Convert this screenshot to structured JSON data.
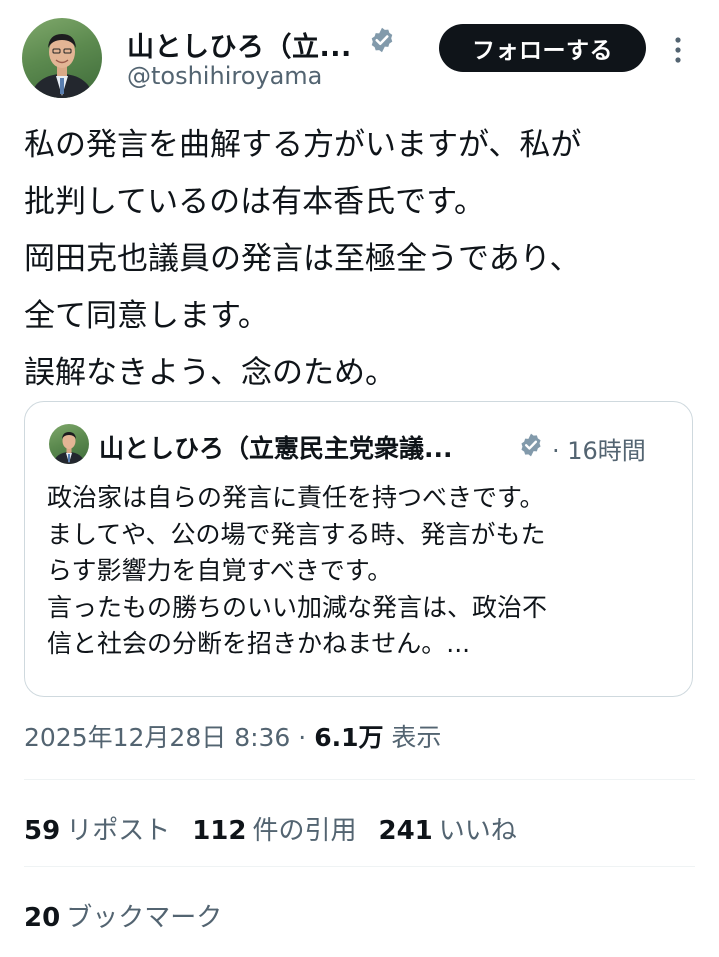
{
  "author": {
    "display_name": "山としひろ（立...",
    "handle": "@toshihiroyama",
    "avatar": "profile-photo"
  },
  "header": {
    "follow_label": "フォローする",
    "more_icon": "more-vertical-icon",
    "verified_icon": "verified-badge-icon"
  },
  "tweet": {
    "lines": [
      "私の発言を曲解する方がいますが、私が",
      "批判しているのは有本香氏です。",
      "岡田克也議員の発言は至極全うであり、",
      "全て同意します。",
      "誤解なきよう、念のため。"
    ]
  },
  "quote": {
    "display_name": "山としひろ（立憲民主党衆議...",
    "time": "· 16時間",
    "lines": [
      "政治家は自らの発言に責任を持つべきです。",
      "ましてや、公の場で発言する時、発言がもた",
      "らす影響力を自覚すべきです。",
      "言ったもの勝ちのいい加減な発言は、政治不",
      "信と社会の分断を招きかねません。..."
    ]
  },
  "meta": {
    "timestamp": "2025年12月28日 8:36 · ",
    "views_count": "6.1万",
    "views_label": " 表示"
  },
  "stats": {
    "reposts_count": "59",
    "reposts_label": "リポスト",
    "quotes_count": "112",
    "quotes_label": "件の引用",
    "likes_count": "241",
    "likes_label": "いいね",
    "bookmarks_count": "20",
    "bookmarks_label": "ブックマーク"
  },
  "colors": {
    "text": "#0f1419",
    "secondary": "#536471",
    "border": "#cfd9de",
    "verified": "#829aab",
    "button_bg": "#0f1419"
  }
}
